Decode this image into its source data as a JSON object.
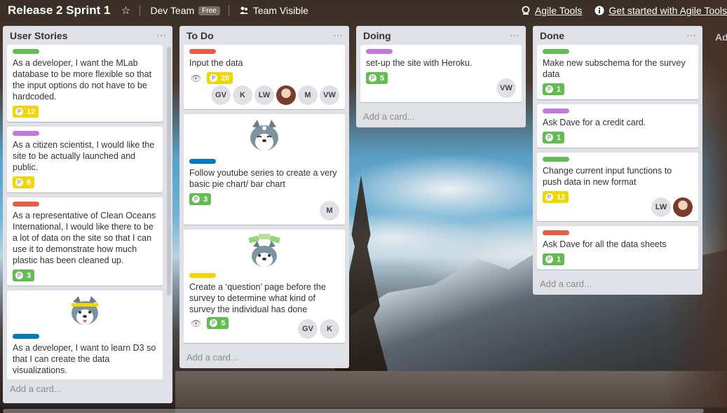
{
  "header": {
    "board_title": "Release 2 Sprint 1",
    "team_name": "Dev Team",
    "team_badge": "Free",
    "visibility": "Team Visible",
    "agile_tools": "Agile Tools",
    "get_started": "Get started with Agile Tools",
    "add_list": "Ad"
  },
  "colors": {
    "green": "#61bd4f",
    "purple": "#c377e0",
    "red": "#eb5a46",
    "blue": "#0079bf",
    "yellow": "#f2d600"
  },
  "lists": [
    {
      "title": "User Stories",
      "add_card": "Add a card...",
      "cards": [
        {
          "label": "green",
          "title": "As a developer, I want the MLab database to be more flexible so that the input options do not have to be hardcoded.",
          "points": "12",
          "points_color": "yellow"
        },
        {
          "label": "purple",
          "title": "As a citizen scientist, I would like the site to be actually launched and public.",
          "points": "8",
          "points_color": "yellow"
        },
        {
          "label": "red",
          "title": "As a representative of Clean Oceans International, I would like there to be a lot of data on the site so that I can use it to demonstrate how much plastic has been cleaned up.",
          "points": "3",
          "points_color": "green"
        },
        {
          "label": "blue",
          "title": "As a developer, I want to learn D3 so that I can create the data visualizations.",
          "sticker": "husky-sticker"
        }
      ]
    },
    {
      "title": "To Do",
      "add_card": "Add a card...",
      "cards": [
        {
          "label": "red",
          "title": "Input the data",
          "points": "20",
          "points_color": "yellow",
          "members": [
            "GV",
            "K",
            "LW",
            "",
            "M",
            "VW"
          ]
        },
        {
          "label": "blue",
          "title": "Follow youtube series to create a very basic pie chart/ bar chart",
          "points": "3",
          "points_color": "green",
          "members": [
            "M"
          ],
          "sticker": "husky-sticker"
        },
        {
          "label": "yellow",
          "title": "Create a ‘question’ page before the survey to determine what kind of survey the individual has done",
          "points": "5",
          "points_color": "green",
          "members": [
            "GV",
            "K"
          ],
          "sticker": "husky-money-sticker"
        }
      ]
    },
    {
      "title": "Doing",
      "add_card": "Add a card...",
      "cards": [
        {
          "label": "purple",
          "title": "set-up the site with Heroku.",
          "points": "5",
          "points_color": "green",
          "members": [
            "VW"
          ]
        }
      ]
    },
    {
      "title": "Done",
      "add_card": "Add a card...",
      "cards": [
        {
          "label": "green",
          "title": "Make new subschema for the survey data",
          "points": "1",
          "points_color": "green"
        },
        {
          "label": "purple",
          "title": "Ask Dave for a credit card.",
          "points": "1",
          "points_color": "green"
        },
        {
          "label": "green",
          "title": "Change current input functions to push data in new format",
          "points": "12",
          "points_color": "yellow",
          "members": [
            "LW",
            ""
          ]
        },
        {
          "label": "red",
          "title": "Ask Dave for all the data sheets",
          "points": "1",
          "points_color": "green"
        }
      ]
    }
  ]
}
